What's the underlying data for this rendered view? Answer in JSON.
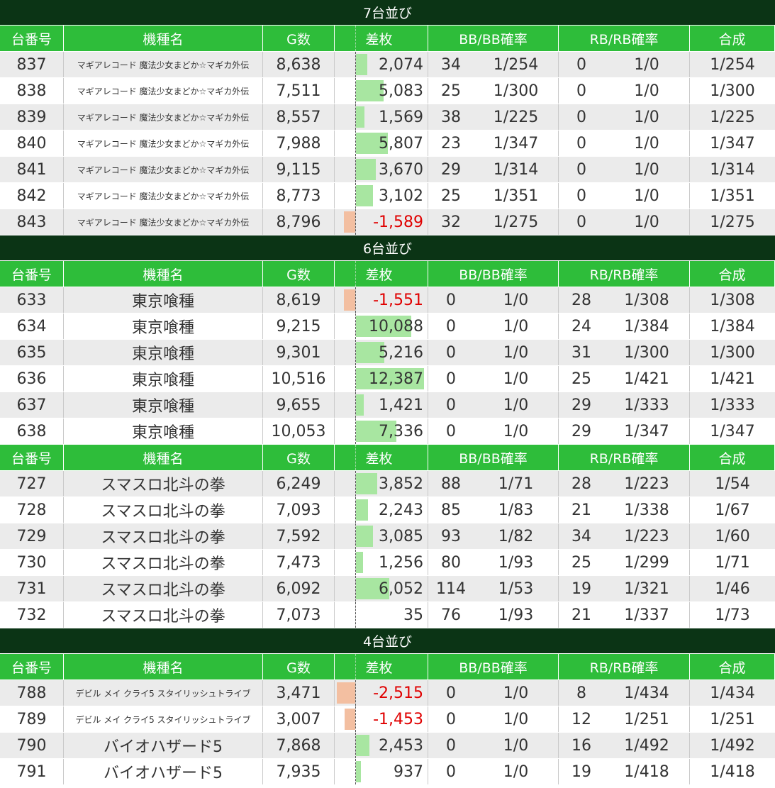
{
  "headers": {
    "unit": "台番号",
    "model": "機種名",
    "games": "G数",
    "diff": "差枚",
    "bb": "BB/BB確率",
    "rb": "RB/RB確率",
    "total": "合成"
  },
  "sections": [
    {
      "title": "7台並び",
      "rows": [
        {
          "unit": "837",
          "model": "マギアレコード 魔法少女まどか☆マギカ外伝",
          "games": "8,638",
          "diff": "2,074",
          "diff_value": 2074,
          "bb": "34",
          "bb_rate": "1/254",
          "rb": "0",
          "rb_rate": "1/0",
          "total": "1/254"
        },
        {
          "unit": "838",
          "model": "マギアレコード 魔法少女まどか☆マギカ外伝",
          "games": "7,511",
          "diff": "5,083",
          "diff_value": 5083,
          "bb": "25",
          "bb_rate": "1/300",
          "rb": "0",
          "rb_rate": "1/0",
          "total": "1/300"
        },
        {
          "unit": "839",
          "model": "マギアレコード 魔法少女まどか☆マギカ外伝",
          "games": "8,557",
          "diff": "1,569",
          "diff_value": 1569,
          "bb": "38",
          "bb_rate": "1/225",
          "rb": "0",
          "rb_rate": "1/0",
          "total": "1/225"
        },
        {
          "unit": "840",
          "model": "マギアレコード 魔法少女まどか☆マギカ外伝",
          "games": "7,988",
          "diff": "5,807",
          "diff_value": 5807,
          "bb": "23",
          "bb_rate": "1/347",
          "rb": "0",
          "rb_rate": "1/0",
          "total": "1/347"
        },
        {
          "unit": "841",
          "model": "マギアレコード 魔法少女まどか☆マギカ外伝",
          "games": "9,115",
          "diff": "3,670",
          "diff_value": 3670,
          "bb": "29",
          "bb_rate": "1/314",
          "rb": "0",
          "rb_rate": "1/0",
          "total": "1/314"
        },
        {
          "unit": "842",
          "model": "マギアレコード 魔法少女まどか☆マギカ外伝",
          "games": "8,773",
          "diff": "3,102",
          "diff_value": 3102,
          "bb": "25",
          "bb_rate": "1/351",
          "rb": "0",
          "rb_rate": "1/0",
          "total": "1/351"
        },
        {
          "unit": "843",
          "model": "マギアレコード 魔法少女まどか☆マギカ外伝",
          "games": "8,796",
          "diff": "-1,589",
          "diff_value": -1589,
          "bb": "32",
          "bb_rate": "1/275",
          "rb": "0",
          "rb_rate": "1/0",
          "total": "1/275"
        }
      ]
    },
    {
      "title": "6台並び",
      "rows": [
        {
          "unit": "633",
          "model": "東京喰種",
          "games": "8,619",
          "diff": "-1,551",
          "diff_value": -1551,
          "bb": "0",
          "bb_rate": "1/0",
          "rb": "28",
          "rb_rate": "1/308",
          "total": "1/308"
        },
        {
          "unit": "634",
          "model": "東京喰種",
          "games": "9,215",
          "diff": "10,088",
          "diff_value": 10088,
          "bb": "0",
          "bb_rate": "1/0",
          "rb": "24",
          "rb_rate": "1/384",
          "total": "1/384"
        },
        {
          "unit": "635",
          "model": "東京喰種",
          "games": "9,301",
          "diff": "5,216",
          "diff_value": 5216,
          "bb": "0",
          "bb_rate": "1/0",
          "rb": "31",
          "rb_rate": "1/300",
          "total": "1/300"
        },
        {
          "unit": "636",
          "model": "東京喰種",
          "games": "10,516",
          "diff": "12,387",
          "diff_value": 12387,
          "bb": "0",
          "bb_rate": "1/0",
          "rb": "25",
          "rb_rate": "1/421",
          "total": "1/421"
        },
        {
          "unit": "637",
          "model": "東京喰種",
          "games": "9,655",
          "diff": "1,421",
          "diff_value": 1421,
          "bb": "0",
          "bb_rate": "1/0",
          "rb": "29",
          "rb_rate": "1/333",
          "total": "1/333"
        },
        {
          "unit": "638",
          "model": "東京喰種",
          "games": "10,053",
          "diff": "7,336",
          "diff_value": 7336,
          "bb": "0",
          "bb_rate": "1/0",
          "rb": "29",
          "rb_rate": "1/347",
          "total": "1/347"
        }
      ]
    },
    {
      "title": "",
      "rows": [
        {
          "unit": "727",
          "model": "スマスロ北斗の拳",
          "games": "6,249",
          "diff": "3,852",
          "diff_value": 3852,
          "bb": "88",
          "bb_rate": "1/71",
          "rb": "28",
          "rb_rate": "1/223",
          "total": "1/54"
        },
        {
          "unit": "728",
          "model": "スマスロ北斗の拳",
          "games": "7,093",
          "diff": "2,243",
          "diff_value": 2243,
          "bb": "85",
          "bb_rate": "1/83",
          "rb": "21",
          "rb_rate": "1/338",
          "total": "1/67"
        },
        {
          "unit": "729",
          "model": "スマスロ北斗の拳",
          "games": "7,592",
          "diff": "3,085",
          "diff_value": 3085,
          "bb": "93",
          "bb_rate": "1/82",
          "rb": "34",
          "rb_rate": "1/223",
          "total": "1/60"
        },
        {
          "unit": "730",
          "model": "スマスロ北斗の拳",
          "games": "7,473",
          "diff": "1,256",
          "diff_value": 1256,
          "bb": "80",
          "bb_rate": "1/93",
          "rb": "25",
          "rb_rate": "1/299",
          "total": "1/71"
        },
        {
          "unit": "731",
          "model": "スマスロ北斗の拳",
          "games": "6,092",
          "diff": "6,052",
          "diff_value": 6052,
          "bb": "114",
          "bb_rate": "1/53",
          "rb": "19",
          "rb_rate": "1/321",
          "total": "1/46"
        },
        {
          "unit": "732",
          "model": "スマスロ北斗の拳",
          "games": "7,073",
          "diff": "35",
          "diff_value": 35,
          "bb": "76",
          "bb_rate": "1/93",
          "rb": "21",
          "rb_rate": "1/337",
          "total": "1/73"
        }
      ]
    },
    {
      "title": "4台並び",
      "rows": [
        {
          "unit": "788",
          "model": "デビル メイ クライ5 スタイリッシュトライブ",
          "games": "3,471",
          "diff": "-2,515",
          "diff_value": -2515,
          "bb": "0",
          "bb_rate": "1/0",
          "rb": "8",
          "rb_rate": "1/434",
          "total": "1/434"
        },
        {
          "unit": "789",
          "model": "デビル メイ クライ5 スタイリッシュトライブ",
          "games": "3,007",
          "diff": "-1,453",
          "diff_value": -1453,
          "bb": "0",
          "bb_rate": "1/0",
          "rb": "12",
          "rb_rate": "1/251",
          "total": "1/251"
        },
        {
          "unit": "790",
          "model": "バイオハザード5",
          "games": "7,868",
          "diff": "2,453",
          "diff_value": 2453,
          "bb": "0",
          "bb_rate": "1/0",
          "rb": "16",
          "rb_rate": "1/492",
          "total": "1/492"
        },
        {
          "unit": "791",
          "model": "バイオハザード5",
          "games": "7,935",
          "diff": "937",
          "diff_value": 937,
          "bb": "0",
          "bb_rate": "1/0",
          "rb": "19",
          "rb_rate": "1/418",
          "total": "1/418"
        }
      ]
    }
  ]
}
